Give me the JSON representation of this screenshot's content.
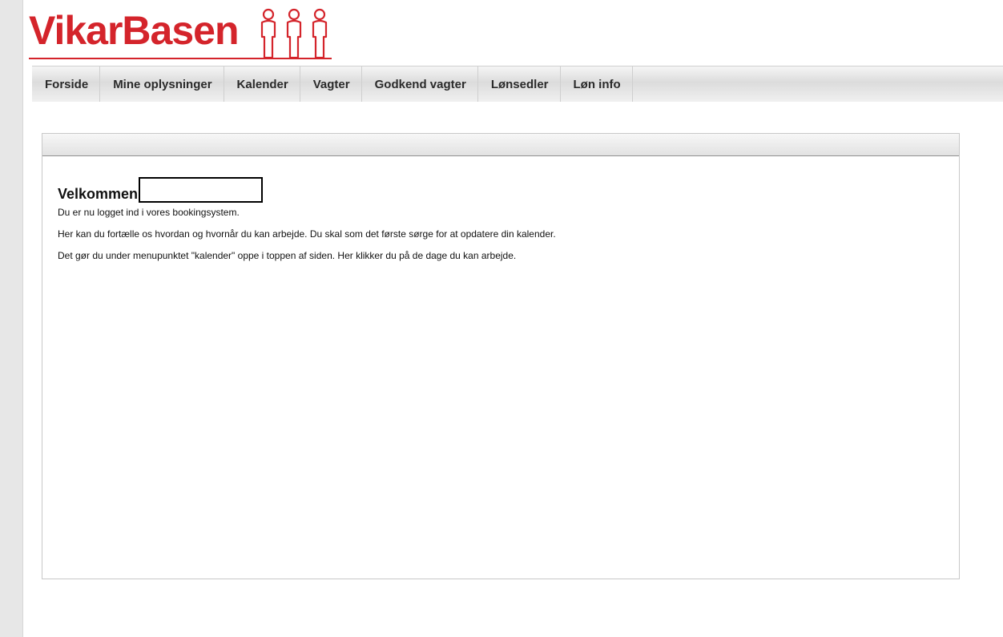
{
  "brand": {
    "logo_text": "VikarBasen",
    "color": "#d4242b"
  },
  "nav": {
    "items": [
      {
        "label": "Forside"
      },
      {
        "label": "Mine oplysninger"
      },
      {
        "label": "Kalender"
      },
      {
        "label": "Vagter"
      },
      {
        "label": "Godkend vagter"
      },
      {
        "label": "Lønsedler"
      },
      {
        "label": "Løn info"
      }
    ]
  },
  "main": {
    "welcome_title": "Velkommen",
    "user_name": "",
    "paragraphs": [
      "Du er nu logget ind i vores bookingsystem.",
      "Her kan du fortælle os hvordan og hvornår du kan arbejde. Du skal som det første sørge for at opdatere din kalender.",
      "Det gør du under menupunktet \"kalender\" oppe i toppen af siden. Her klikker du på de dage du kan arbejde."
    ]
  }
}
